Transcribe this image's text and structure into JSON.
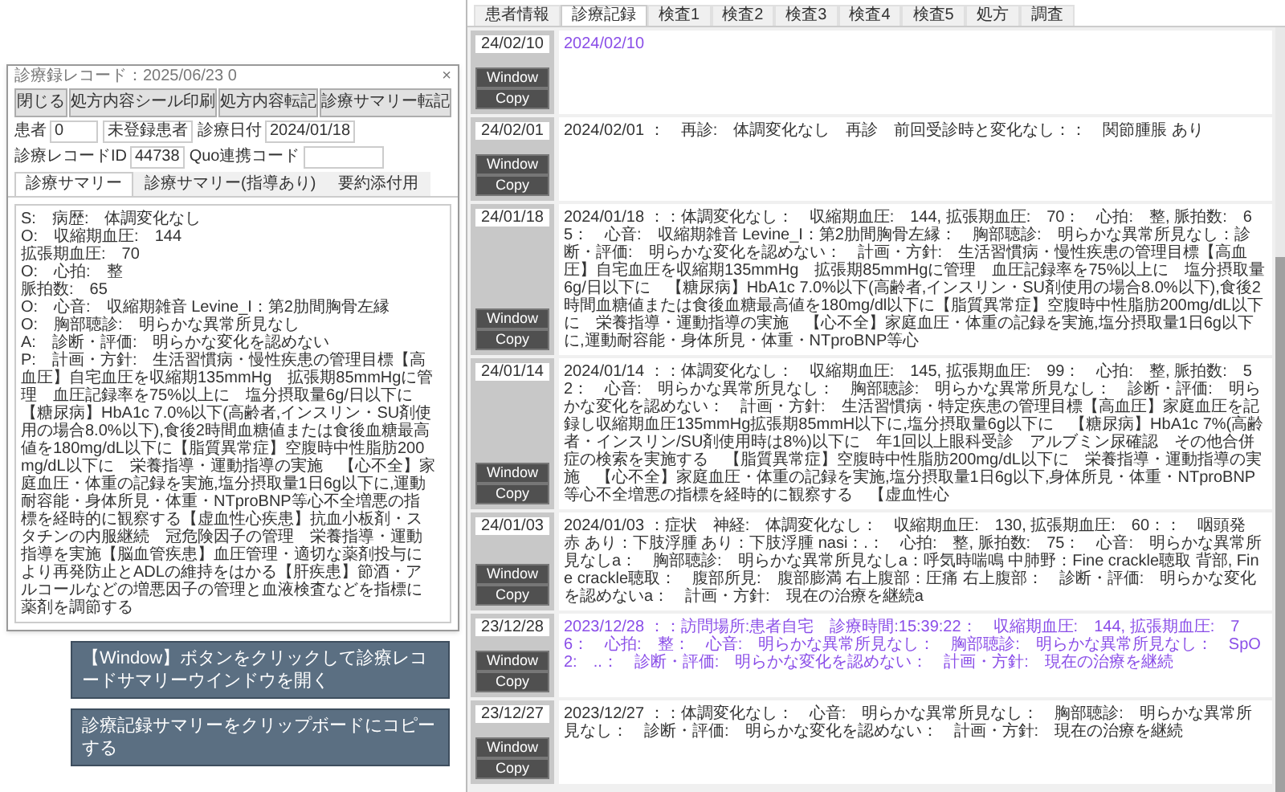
{
  "record_window": {
    "title": "診療録レコード：2025/06/23 0",
    "close": "×",
    "buttons": [
      "閉じる",
      "処方内容シール印刷",
      "処方内容転記",
      "診療サマリー転記"
    ],
    "fields": [
      {
        "label": "患者",
        "value": "0"
      },
      {
        "value": "未登録患者"
      },
      {
        "label": "診療日付",
        "value": "2024/01/18"
      },
      {
        "label": "診療レコードID",
        "value": "44738"
      },
      {
        "label": "Quo連携コード"
      }
    ],
    "tabs": [
      {
        "label": "診療サマリー",
        "selected": true
      },
      {
        "label": "診療サマリー(指導あり)",
        "selected": false
      },
      {
        "label": "要約添付用",
        "selected": false
      }
    ],
    "summary_lines": [
      "S:　病歴:　体調変化なし",
      "O:　収縮期血圧:　144",
      "拡張期血圧:　70",
      "O:　心拍:　整",
      "脈拍数:　65",
      "O:　心音:　収縮期雑音 Levine_I：第2肋間胸骨左縁",
      "O:　胸部聴診:　明らかな異常所見なし",
      "A:　診断・評価:　明らかな変化を認めない",
      "P:　計画・方針:　生活習慣病・慢性疾患の管理目標【高血圧】自宅血圧を収縮期135mmHg　拡張期85mmHgに管理　血圧記録率を75%以上に　塩分摂取量6g/日以下に【糖尿病】HbA1c 7.0%以下(高齢者,インスリン・SU剤使用の場合8.0%以下),食後2時間血糖値または食後血糖最高値を180mg/dL以下に【脂質異常症】空腹時中性脂肪200mg/dL以下に　栄養指導・運動指導の実施　【心不全】家庭血圧・体重の記録を実施,塩分摂取量1日6g以下に,運動耐容能・身体所見・体重・NTproBNP等心不全増悪の指標を経時的に観察する【虚血性心疾患】抗血小板剤・スタチンの内服継続　冠危険因子の管理　栄養指導・運動指導を実施【脳血管疾患】血圧管理・適切な薬剤投与により再発防止とADLの維持をはかる【肝疾患】節酒・アルコールなどの増悪因子の管理と血液検査などを指標に薬剤を調節する"
    ]
  },
  "callouts": [
    "【Window】ボタンをクリックして診療レコードサマリーウインドウを開く",
    "診療記録サマリーをクリップボードにコピーする"
  ],
  "tabs": [
    {
      "label": "患者情報",
      "selected": false
    },
    {
      "label": "診療記録",
      "selected": true
    },
    {
      "label": "検査1",
      "selected": false
    },
    {
      "label": "検査2",
      "selected": false
    },
    {
      "label": "検査3",
      "selected": false
    },
    {
      "label": "検査4",
      "selected": false
    },
    {
      "label": "検査5",
      "selected": false
    },
    {
      "label": "処方",
      "selected": false
    },
    {
      "label": "調査",
      "selected": false
    }
  ],
  "records": [
    {
      "date": "24/02/10",
      "text": "2024/02/10",
      "color": "#8a4ee8",
      "buttons": [
        "Window",
        "Copy"
      ]
    },
    {
      "date": "24/02/01",
      "text": "2024/02/01 ：　再診:　体調変化なし　再診　前回受診時と変化なし：：　関節腫脹 あり",
      "color": "#333333",
      "buttons": [
        "Window",
        "Copy"
      ]
    },
    {
      "date": "24/01/18",
      "text": "2024/01/18 ：：体調変化なし：　収縮期血圧:　144, 拡張期血圧:　70：　心拍:　整, 脈拍数:　65：　心音:　収縮期雑音 Levine_I：第2肋間胸骨左縁：　胸部聴診:　明らかな異常所見なし：診断・評価:　明らかな変化を認めない：　計画・方針:　生活習慣病・慢性疾患の管理目標【高血圧】自宅血圧を収縮期135mmHg　拡張期85mmHgに管理　血圧記録率を75%以上に　塩分摂取量6g/日以下に　【糖尿病】HbA1c 7.0%以下(高齢者,インスリン・SU剤使用の場合8.0%以下),食後2時間血糖値または食後血糖最高値を180mg/dl以下に【脂質異常症】空腹時中性脂肪200mg/dL以下に　栄養指導・運動指導の実施　【心不全】家庭血圧・体重の記録を実施,塩分摂取量1日6g以下に,運動耐容能・身体所見・体重・NTproBNP等心",
      "color": "#333333",
      "buttons": [
        "Window",
        "Copy"
      ]
    },
    {
      "date": "24/01/14",
      "text": "2024/01/14 ：：体調変化なし：　収縮期血圧:　145, 拡張期血圧:　99：　心拍:　整, 脈拍数:　52：　心音:　明らかな異常所見なし：　胸部聴診:　明らかな異常所見なし：　診断・評価:　明らかな変化を認めない：　計画・方針:　生活習慣病・特定疾患の管理目標【高血圧】家庭血圧を記録し収縮期血圧135mmHg拡張期85mmH以下に,塩分摂取量6g以下に　【糖尿病】HbA1c 7%(高齢者・インスリン/SU剤使用時は8%)以下に　年1回以上眼科受診　アルブミン尿確認　その他合併症の検索を実施する　【脂質異常症】空腹時中性脂肪200mg/dL以下に　栄養指導・運動指導の実施　【心不全】家庭血圧・体重の記録を実施,塩分摂取量1日6g以下,身体所見・体重・NTproBNP等心不全増悪の指標を経時的に観察する　【虚血性心",
      "color": "#333333",
      "buttons": [
        "Window",
        "Copy"
      ]
    },
    {
      "date": "24/01/03",
      "text": "2024/01/03 ：症状　神経:　体調変化なし：　収縮期血圧:　130, 拡張期血圧:　60：：　咽頭発赤 あり：下肢浮腫 あり：下肢浮腫 nasi：.：　心拍:　整, 脈拍数:　75：　心音:　明らかな異常所見なしa：　胸部聴診:　明らかな異常所見なしa：呼気時喘鳴 中肺野：Fine crackle聴取 背部, Fine crackle聴取：　腹部所見:　腹部膨満 右上腹部：圧痛 右上腹部：　診断・評価:　明らかな変化を認めないa：　計画・方針:　現在の治療を継続a",
      "color": "#333333",
      "buttons": [
        "Window",
        "Copy"
      ]
    },
    {
      "date": "23/12/28",
      "text": "2023/12/28 ：：訪問場所:患者自宅　診療時間:15:39:22：　収縮期血圧:　144, 拡張期血圧:　76：　心拍:　整：　心音:　明らかな異常所見なし：　胸部聴診:　明らかな異常所見なし：　SpO2:　..：　診断・評価:　明らかな変化を認めない：　計画・方針:　現在の治療を継続",
      "color": "#8a4ee8",
      "buttons": [
        "Window",
        "Copy"
      ]
    },
    {
      "date": "23/12/27",
      "text": "2023/12/27 ：：体調変化なし：　心音:　明らかな異常所見なし：　胸部聴診:　明らかな異常所見なし：　診断・評価:　明らかな変化を認めない：　計画・方針:　現在の治療を継続",
      "color": "#333333",
      "buttons": [
        "Window",
        "Copy"
      ]
    }
  ]
}
